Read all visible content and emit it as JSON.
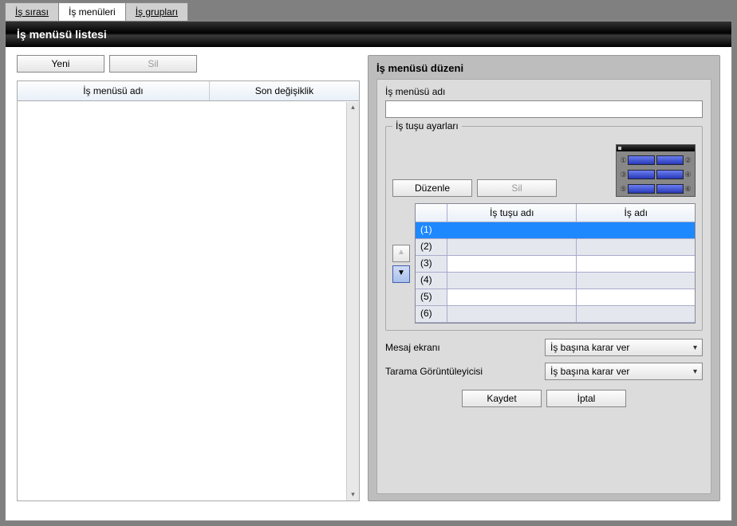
{
  "tabs": {
    "order": "İş sırası",
    "menus": "İş menüleri",
    "groups": "İş grupları"
  },
  "title": "İş menüsü listesi",
  "left_buttons": {
    "new": "Yeni",
    "delete": "Sil"
  },
  "list_columns": {
    "name": "İş menüsü adı",
    "modified": "Son değişiklik"
  },
  "panel": {
    "title": "İş menüsü düzeni",
    "name_label": "İş menüsü adı",
    "name_value": "",
    "key_group": "İş tuşu ayarları",
    "edit": "Düzenle",
    "delete": "Sil",
    "grid_headers": {
      "key": "İş tuşu adı",
      "job": "İş adı"
    },
    "rows": [
      {
        "idx": "(1)",
        "key": "",
        "job": ""
      },
      {
        "idx": "(2)",
        "key": "",
        "job": ""
      },
      {
        "idx": "(3)",
        "key": "",
        "job": ""
      },
      {
        "idx": "(4)",
        "key": "",
        "job": ""
      },
      {
        "idx": "(5)",
        "key": "",
        "job": ""
      },
      {
        "idx": "(6)",
        "key": "",
        "job": ""
      }
    ],
    "preview_numbers": [
      "①",
      "②",
      "③",
      "④",
      "⑤",
      "⑥"
    ],
    "msg_label": "Mesaj ekranı",
    "msg_value": "İş başına karar ver",
    "viewer_label": "Tarama Görüntüleyicisi",
    "viewer_value": "İş başına karar ver",
    "save": "Kaydet",
    "cancel": "İptal"
  }
}
